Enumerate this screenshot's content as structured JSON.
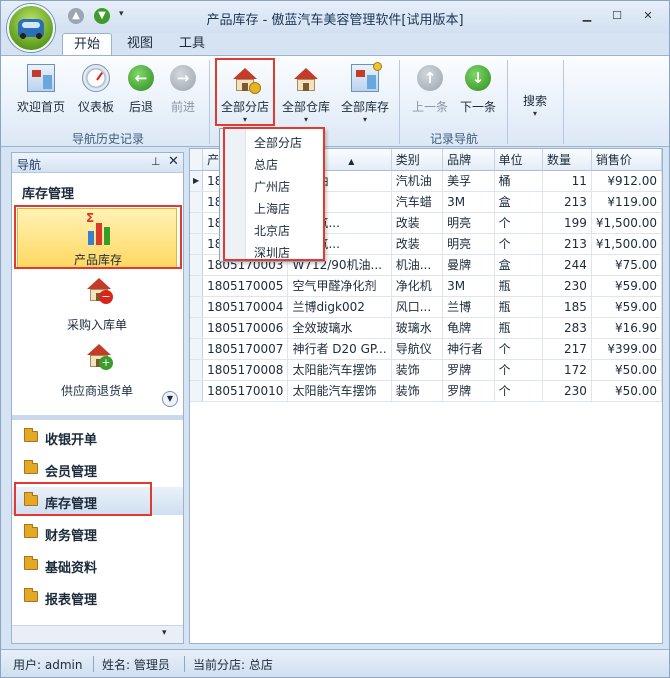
{
  "window": {
    "title": "产品库存 - 傲蓝汽车美容管理软件[试用版本]",
    "min": "▁",
    "max": "☐",
    "close": "✕"
  },
  "quick_access": {
    "up": "▲",
    "down": "▼",
    "dropdown": "▾"
  },
  "ribbon": {
    "tabs": [
      "开始",
      "视图",
      "工具"
    ],
    "nav_history": {
      "label": "导航历史记录",
      "buttons": [
        "欢迎首页",
        "仪表板",
        "后退",
        "前进"
      ]
    },
    "store_group": {
      "buttons": [
        "全部分店",
        "全部仓库",
        "全部库存"
      ]
    },
    "record_nav": {
      "label": "记录导航",
      "buttons": [
        "上一条",
        "下一条"
      ]
    },
    "search": "搜索",
    "arrow": "▾"
  },
  "store_dropdown": [
    "全部分店",
    "总店",
    "广州店",
    "上海店",
    "北京店",
    "深圳店"
  ],
  "nav": {
    "title": "导航",
    "pin": "⊥",
    "close": "✕",
    "section": "库存管理",
    "tools": [
      "产品库存",
      "采购入库单",
      "供应商退货单"
    ],
    "categories": [
      "收银开单",
      "会员管理",
      "库存管理",
      "财务管理",
      "基础资料",
      "报表管理"
    ],
    "scroll_down": "▼",
    "bottom_arrow": "▾"
  },
  "grid": {
    "columns": [
      "产",
      "称",
      "类别",
      "品牌",
      "单位",
      "数量",
      "销售价"
    ],
    "sort_marker": "▲",
    "current_marker": "▶",
    "rows": [
      [
        "18",
        "成机油",
        "汽机油",
        "美孚",
        "桶",
        "11",
        "¥912.00"
      ],
      [
        "18",
        "车蜡",
        "汽车蜡",
        "3M",
        "盒",
        "213",
        "¥119.00"
      ],
      [
        "18",
        "双光氙...",
        "改装",
        "明亮",
        "个",
        "199",
        "¥1,500.00"
      ],
      [
        "18",
        "双光氙...",
        "改装",
        "明亮",
        "个",
        "213",
        "¥1,500.00"
      ],
      [
        "1805170003",
        "W712/90机油...",
        "机油...",
        "曼牌",
        "盒",
        "244",
        "¥75.00"
      ],
      [
        "1805170005",
        "空气甲醛净化剂",
        "净化机",
        "3M",
        "瓶",
        "230",
        "¥59.00"
      ],
      [
        "1805170004",
        "兰博digk002",
        "风口...",
        "兰博",
        "瓶",
        "185",
        "¥59.00"
      ],
      [
        "1805170006",
        "全效玻璃水",
        "玻璃水",
        "龟牌",
        "瓶",
        "283",
        "¥16.90"
      ],
      [
        "1805170007",
        "神行者 D20 GP...",
        "导航仪",
        "神行者",
        "个",
        "217",
        "¥399.00"
      ],
      [
        "1805170008",
        "太阳能汽车摆饰",
        "装饰",
        "罗牌",
        "个",
        "172",
        "¥50.00"
      ],
      [
        "1805170010",
        "太阳能汽车摆饰",
        "装饰",
        "罗牌",
        "个",
        "230",
        "¥50.00"
      ]
    ]
  },
  "status": {
    "user": "用户: admin",
    "name": "姓名: 管理员",
    "branch": "当前分店: 总店"
  },
  "colors": {
    "highlight_frame": "#e23a2f",
    "selected_tool": "#ffd862"
  }
}
